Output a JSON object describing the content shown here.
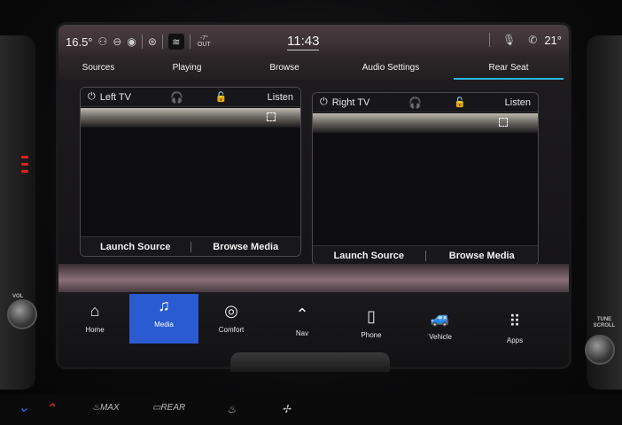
{
  "status_bar": {
    "outside_temp": "16.5°",
    "ambient_label": "-7°",
    "ambient_unit": "OUT",
    "time": "11:43",
    "inside_temp": "21°"
  },
  "tabs": [
    {
      "label": "Sources"
    },
    {
      "label": "Playing"
    },
    {
      "label": "Browse"
    },
    {
      "label": "Audio Settings"
    },
    {
      "label": "Rear Seat",
      "active": true
    }
  ],
  "rear_seat": {
    "left_tv": {
      "title": "Left TV",
      "listen_label": "Listen",
      "launch_label": "Launch Source",
      "browse_label": "Browse Media"
    },
    "right_tv": {
      "title": "Right TV",
      "listen_label": "Listen",
      "launch_label": "Launch Source",
      "browse_label": "Browse Media"
    }
  },
  "nav": [
    {
      "label": "Home",
      "icon": "home-icon"
    },
    {
      "label": "Media",
      "icon": "music-note-icon",
      "active": true
    },
    {
      "label": "Comfort",
      "icon": "seat-heat-icon"
    },
    {
      "label": "Nav",
      "icon": "navigation-arrow-icon"
    },
    {
      "label": "Phone",
      "icon": "phone-icon"
    },
    {
      "label": "Vehicle",
      "icon": "car-icon"
    },
    {
      "label": "Apps",
      "icon": "apps-grid-icon"
    }
  ],
  "side_controls": {
    "left_knob_label": "VOL",
    "right_knob_label": "TUNE SCROLL"
  },
  "climate_bar": {
    "max_label": "MAX",
    "rear_label": "REAR"
  },
  "colors": {
    "accent": "#29b7e0",
    "active_nav": "#2b5bd1"
  }
}
